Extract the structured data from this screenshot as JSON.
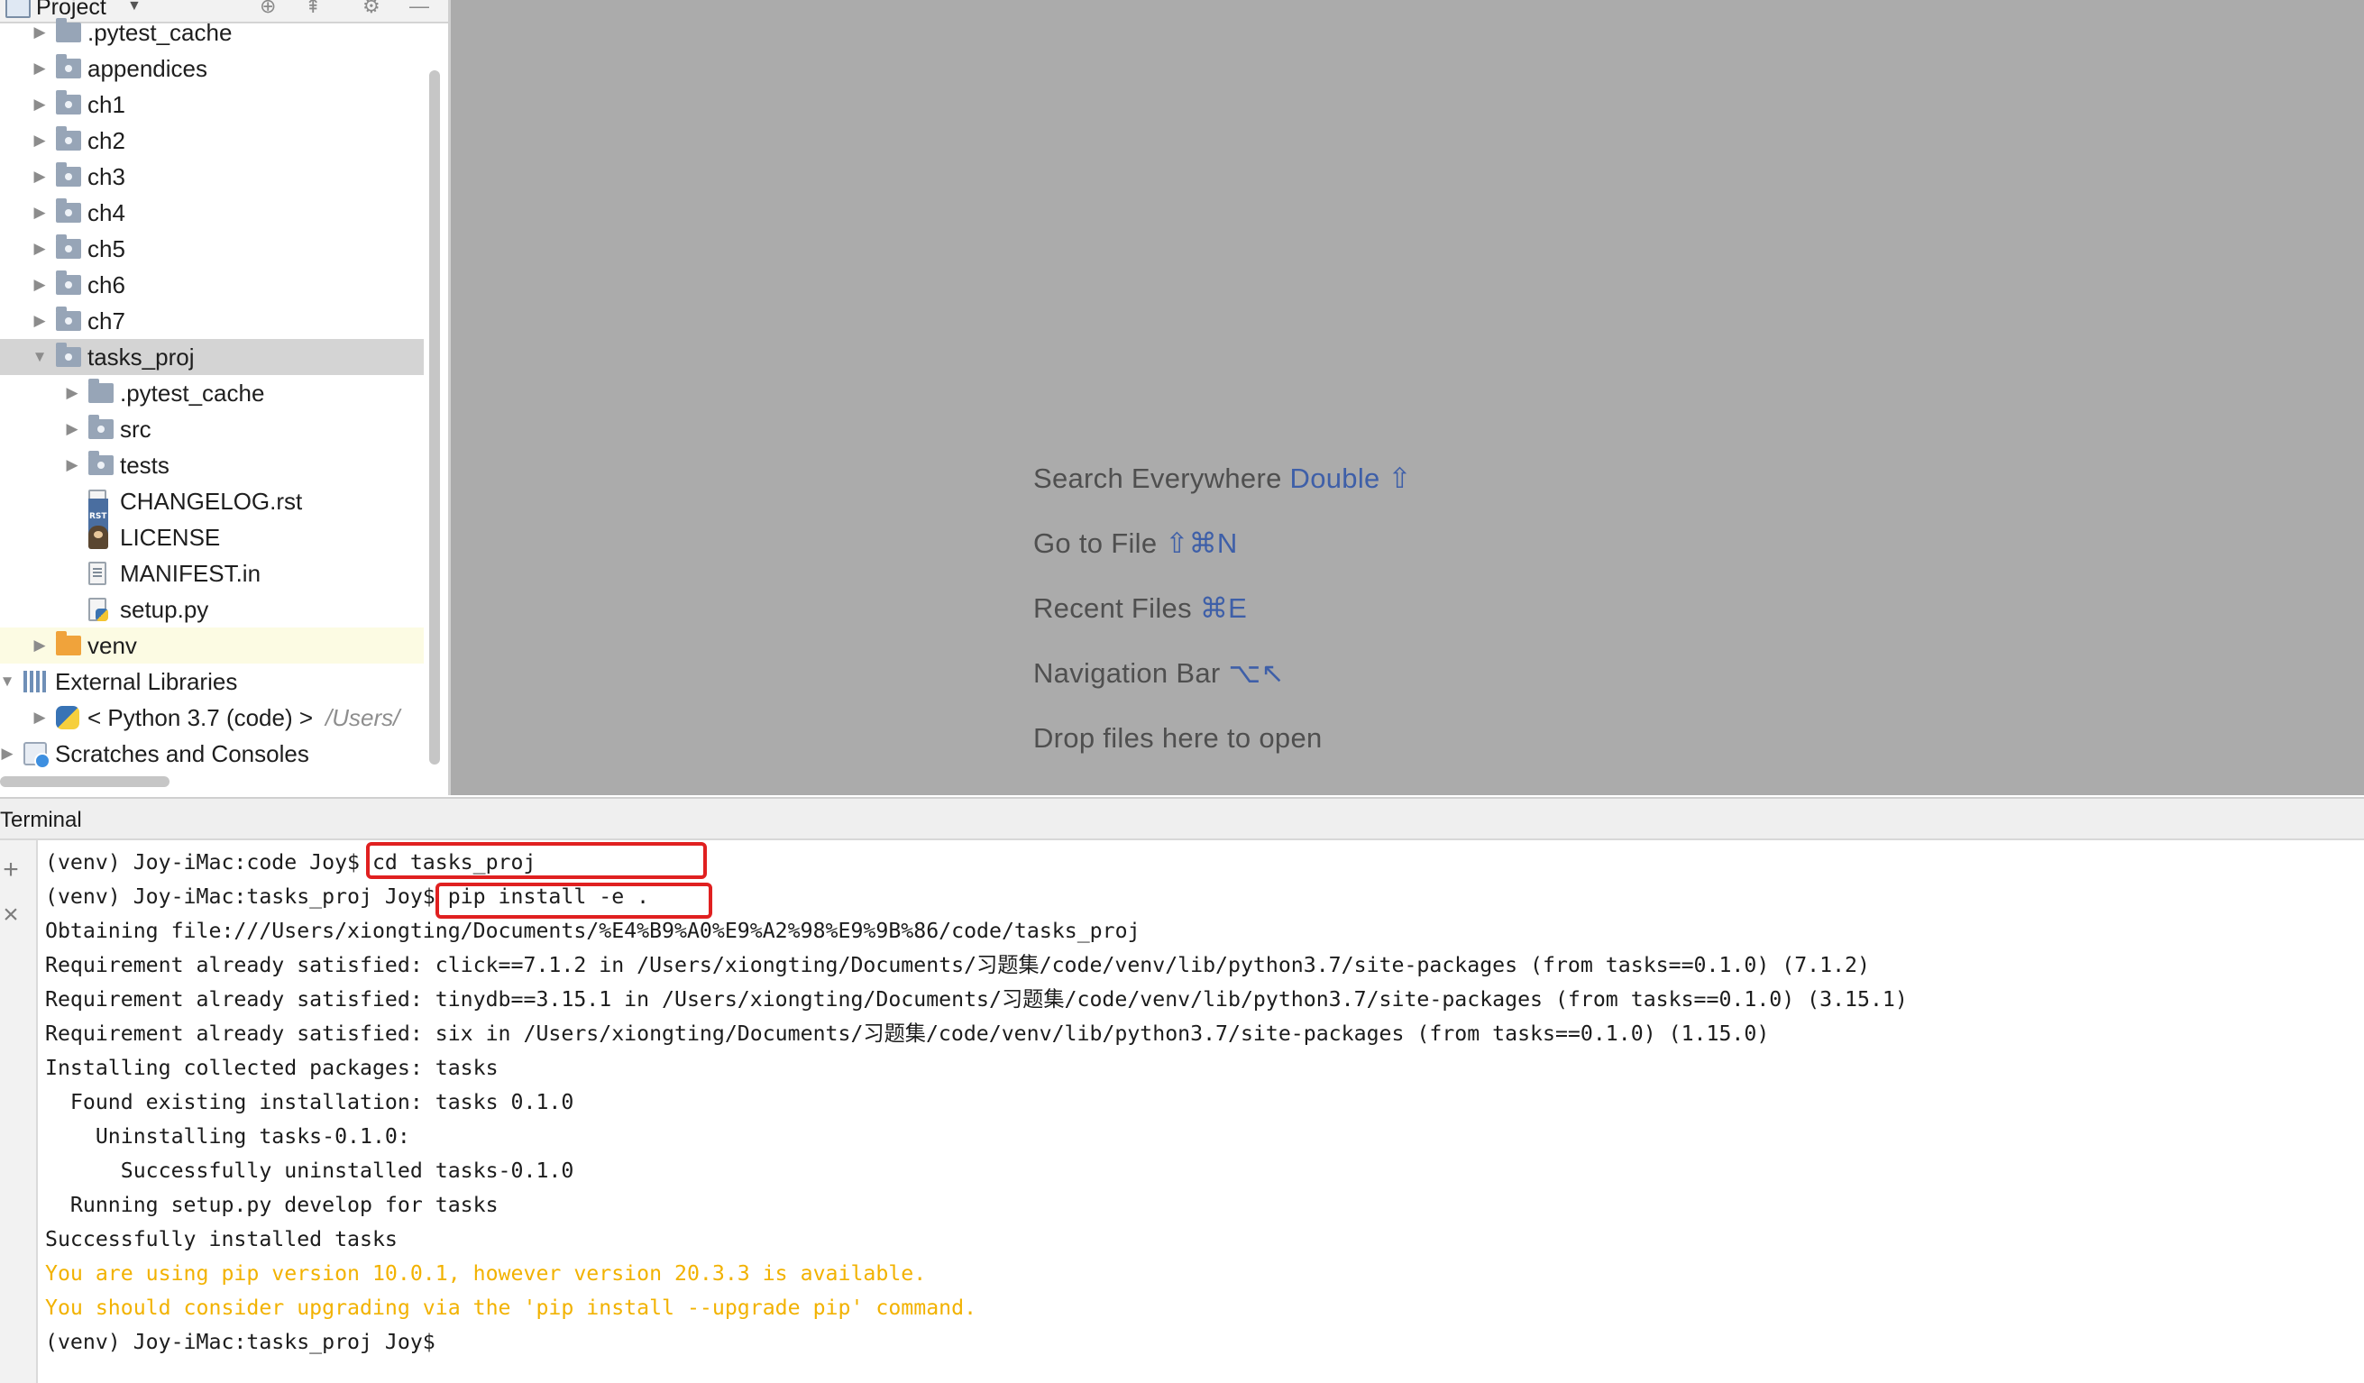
{
  "project_panel": {
    "title": "Project",
    "header_tools": [
      "locate-icon",
      "collapse-icon",
      "settings-icon",
      "hide-icon"
    ],
    "items": [
      {
        "label": ".pytest_cache",
        "icon": "folder-icon",
        "depth": 1,
        "expandable": true
      },
      {
        "label": "appendices",
        "icon": "package-folder-icon",
        "depth": 1,
        "expandable": true
      },
      {
        "label": "ch1",
        "icon": "package-folder-icon",
        "depth": 1,
        "expandable": true
      },
      {
        "label": "ch2",
        "icon": "package-folder-icon",
        "depth": 1,
        "expandable": true
      },
      {
        "label": "ch3",
        "icon": "package-folder-icon",
        "depth": 1,
        "expandable": true
      },
      {
        "label": "ch4",
        "icon": "package-folder-icon",
        "depth": 1,
        "expandable": true
      },
      {
        "label": "ch5",
        "icon": "package-folder-icon",
        "depth": 1,
        "expandable": true
      },
      {
        "label": "ch6",
        "icon": "package-folder-icon",
        "depth": 1,
        "expandable": true
      },
      {
        "label": "ch7",
        "icon": "package-folder-icon",
        "depth": 1,
        "expandable": true
      },
      {
        "label": "tasks_proj",
        "icon": "package-folder-icon",
        "depth": 1,
        "expandable": true,
        "expanded": true,
        "selected": true
      },
      {
        "label": ".pytest_cache",
        "icon": "folder-icon",
        "depth": 2,
        "expandable": true
      },
      {
        "label": "src",
        "icon": "package-folder-icon",
        "depth": 2,
        "expandable": true
      },
      {
        "label": "tests",
        "icon": "package-folder-icon",
        "depth": 2,
        "expandable": true
      },
      {
        "label": "CHANGELOG.rst",
        "icon": "rst-file-icon",
        "depth": 2
      },
      {
        "label": "LICENSE",
        "icon": "license-file-icon",
        "depth": 2
      },
      {
        "label": "MANIFEST.in",
        "icon": "text-file-icon",
        "depth": 2
      },
      {
        "label": "setup.py",
        "icon": "python-file-icon",
        "depth": 2
      },
      {
        "label": "venv",
        "icon": "excluded-folder-icon",
        "depth": 1,
        "expandable": true,
        "highlighted": true
      },
      {
        "label": "External Libraries",
        "icon": "libraries-icon",
        "depth": 0,
        "expandable": true,
        "expanded": true
      },
      {
        "label": "< Python 3.7 (code) >",
        "extra": "/Users/",
        "icon": "python-sdk-icon",
        "depth": 1,
        "expandable": true
      },
      {
        "label": "Scratches and Consoles",
        "icon": "scratches-icon",
        "depth": 0,
        "expandable": true
      }
    ]
  },
  "editor_hints": [
    {
      "text": "Search Everywhere",
      "shortcut": "Double ⇧"
    },
    {
      "text": "Go to File",
      "shortcut": "⇧⌘N"
    },
    {
      "text": "Recent Files",
      "shortcut": "⌘E"
    },
    {
      "text": "Navigation Bar",
      "shortcut": "⌥↖"
    },
    {
      "text": "Drop files here to open",
      "shortcut": ""
    }
  ],
  "terminal": {
    "title": "Terminal",
    "tools": [
      "add-icon",
      "close-icon"
    ],
    "lines": [
      {
        "text": "(venv) Joy-iMac:code Joy$ cd tasks_proj",
        "style": "normal"
      },
      {
        "text": "(venv) Joy-iMac:tasks_proj Joy$ pip install -e .",
        "style": "normal"
      },
      {
        "text": "Obtaining file:///Users/xiongting/Documents/%E4%B9%A0%E9%A2%98%E9%9B%86/code/tasks_proj",
        "style": "normal"
      },
      {
        "text": "Requirement already satisfied: click==7.1.2 in /Users/xiongting/Documents/习题集/code/venv/lib/python3.7/site-packages (from tasks==0.1.0) (7.1.2)",
        "style": "normal"
      },
      {
        "text": "Requirement already satisfied: tinydb==3.15.1 in /Users/xiongting/Documents/习题集/code/venv/lib/python3.7/site-packages (from tasks==0.1.0) (3.15.1)",
        "style": "normal"
      },
      {
        "text": "Requirement already satisfied: six in /Users/xiongting/Documents/习题集/code/venv/lib/python3.7/site-packages (from tasks==0.1.0) (1.15.0)",
        "style": "normal"
      },
      {
        "text": "Installing collected packages: tasks",
        "style": "normal"
      },
      {
        "text": "  Found existing installation: tasks 0.1.0",
        "style": "normal"
      },
      {
        "text": "    Uninstalling tasks-0.1.0:",
        "style": "normal"
      },
      {
        "text": "      Successfully uninstalled tasks-0.1.0",
        "style": "normal"
      },
      {
        "text": "  Running setup.py develop for tasks",
        "style": "normal"
      },
      {
        "text": "Successfully installed tasks",
        "style": "normal"
      },
      {
        "text": "You are using pip version 10.0.1, however version 20.3.3 is available.",
        "style": "warn"
      },
      {
        "text": "You should consider upgrading via the 'pip install --upgrade pip' command.",
        "style": "warn"
      },
      {
        "text": "(venv) Joy-iMac:tasks_proj Joy$",
        "style": "normal"
      }
    ]
  },
  "colors": {
    "editor_background": "#ababab",
    "hint_text": "#4f4f4f",
    "hint_shortcut": "#3e5fa8",
    "selection": "#d4d4d4",
    "terminal_warning": "#f2b200",
    "annotation_box": "#e02020"
  }
}
